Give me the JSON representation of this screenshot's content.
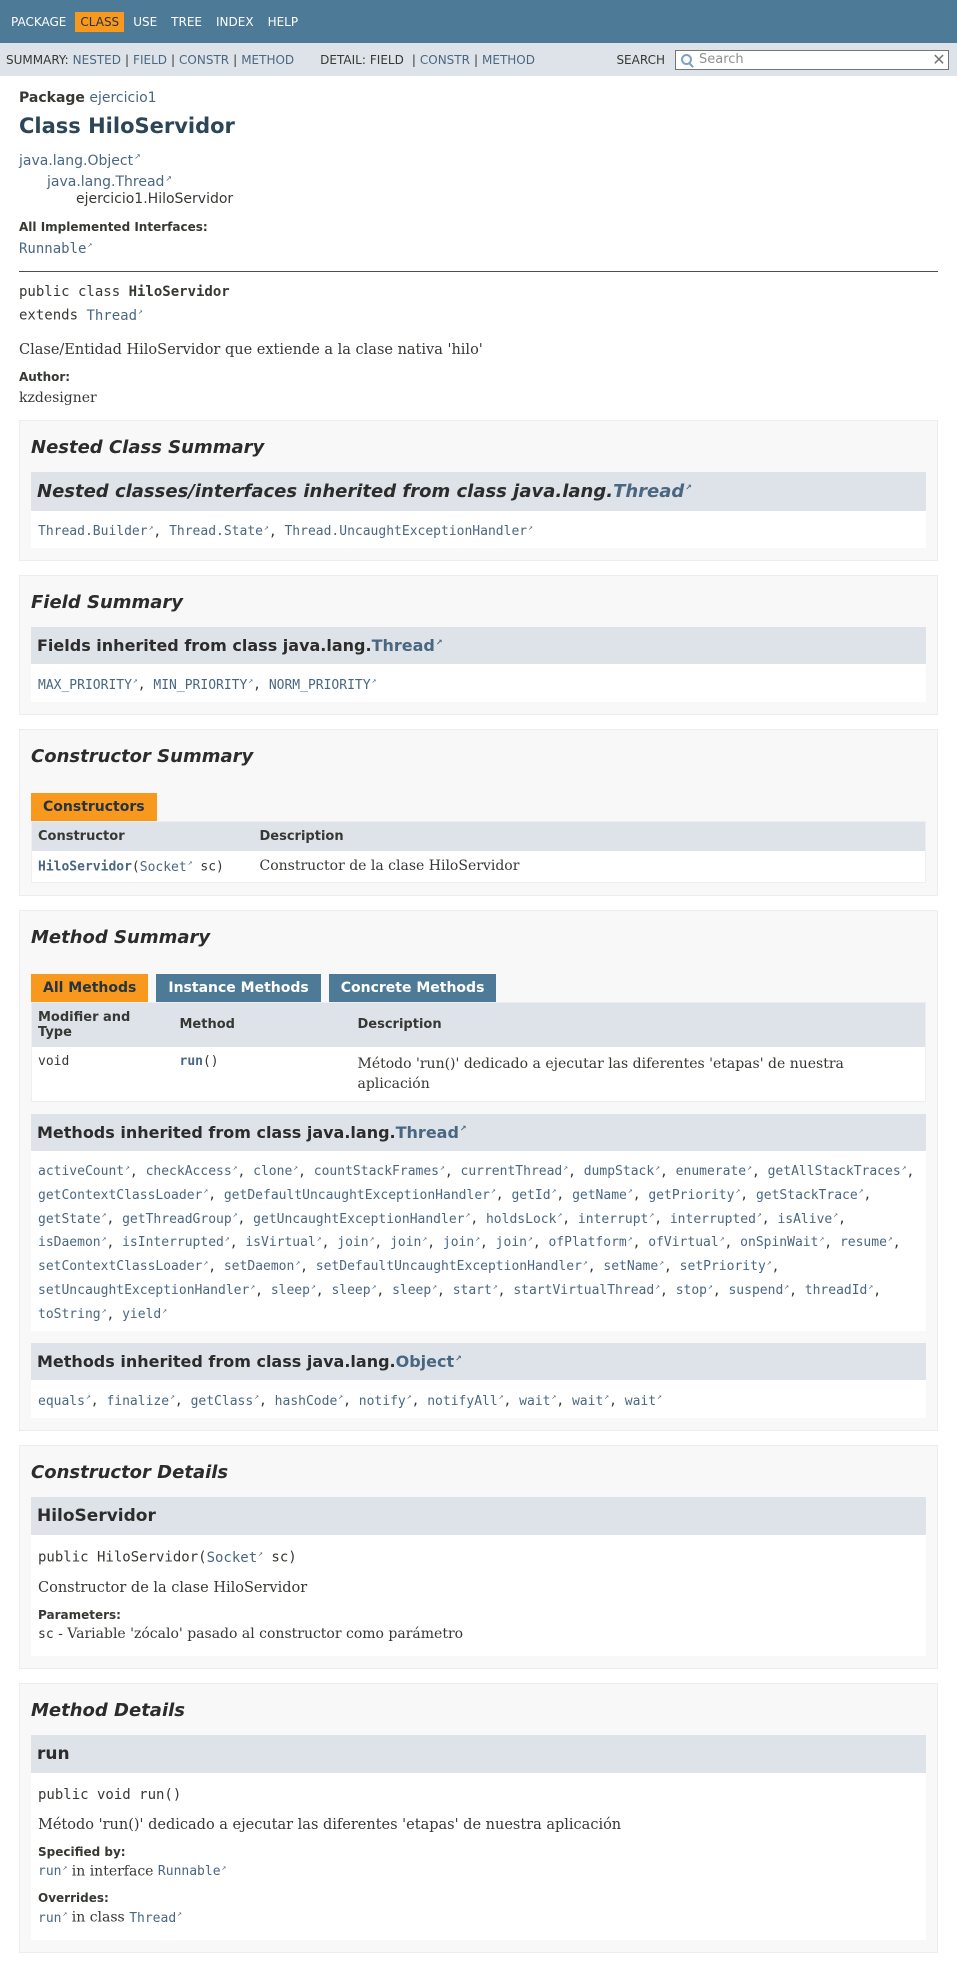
{
  "topnav": {
    "items": [
      {
        "label": "PACKAGE",
        "active": false
      },
      {
        "label": "CLASS",
        "active": true
      },
      {
        "label": "USE",
        "active": false
      },
      {
        "label": "TREE",
        "active": false
      },
      {
        "label": "INDEX",
        "active": false
      },
      {
        "label": "HELP",
        "active": false
      }
    ]
  },
  "subnav": {
    "summary_label": "SUMMARY:",
    "summary_links": [
      "NESTED",
      "FIELD",
      "CONSTR",
      "METHOD"
    ],
    "detail_label": "DETAIL:",
    "detail_plain": "FIELD",
    "detail_links": [
      "CONSTR",
      "METHOD"
    ],
    "search_label": "SEARCH",
    "search_placeholder": "Search",
    "search_value": "",
    "clear_glyph": "✕"
  },
  "header": {
    "package_label": "Package",
    "package_name": "ejercicio1",
    "title": "Class HiloServidor",
    "inheritance": [
      "java.lang.Object",
      "java.lang.Thread",
      "ejercicio1.HiloServidor"
    ],
    "impl_label": "All Implemented Interfaces:",
    "impl_value": "Runnable",
    "sig_line1_prefix": "public class ",
    "sig_line1_name": "HiloServidor",
    "sig_line2_prefix": "extends ",
    "sig_line2_link": "Thread",
    "description": "Clase/Entidad HiloServidor que extiende a la clase nativa 'hilo'",
    "author_label": "Author:",
    "author": "kzdesigner"
  },
  "nested": {
    "title": "Nested Class Summary",
    "inherited_prefix": "Nested classes/interfaces inherited from class java.lang.",
    "inherited_link": "Thread",
    "items": [
      "Thread.Builder",
      "Thread.State",
      "Thread.UncaughtExceptionHandler"
    ]
  },
  "fields": {
    "title": "Field Summary",
    "inherited_prefix": "Fields inherited from class java.lang.",
    "inherited_link": "Thread",
    "items": [
      "MAX_PRIORITY",
      "MIN_PRIORITY",
      "NORM_PRIORITY"
    ]
  },
  "constructors": {
    "title": "Constructor Summary",
    "tab": "Constructors",
    "col1": "Constructor",
    "col2": "Description",
    "row_name": "HiloServidor",
    "row_paren_open": "(",
    "row_param_type": "Socket",
    "row_param_rest": " sc)",
    "row_desc": "Constructor de la clase HiloServidor"
  },
  "methods": {
    "title": "Method Summary",
    "tabs": [
      {
        "label": "All Methods",
        "active": true
      },
      {
        "label": "Instance Methods",
        "active": false
      },
      {
        "label": "Concrete Methods",
        "active": false
      }
    ],
    "col1": "Modifier and Type",
    "col2": "Method",
    "col3": "Description",
    "row_type": "void",
    "row_name": "run",
    "row_parens": "()",
    "row_desc": "Método 'run()' dedicado a ejecutar las diferentes 'etapas' de nuestra aplicación",
    "thread_prefix": "Methods inherited from class java.lang.",
    "thread_link": "Thread",
    "thread_items": [
      "activeCount",
      "checkAccess",
      "clone",
      "countStackFrames",
      "currentThread",
      "dumpStack",
      "enumerate",
      "getAllStackTraces",
      "getContextClassLoader",
      "getDefaultUncaughtExceptionHandler",
      "getId",
      "getName",
      "getPriority",
      "getStackTrace",
      "getState",
      "getThreadGroup",
      "getUncaughtExceptionHandler",
      "holdsLock",
      "interrupt",
      "interrupted",
      "isAlive",
      "isDaemon",
      "isInterrupted",
      "isVirtual",
      "join",
      "join",
      "join",
      "join",
      "ofPlatform",
      "ofVirtual",
      "onSpinWait",
      "resume",
      "setContextClassLoader",
      "setDaemon",
      "setDefaultUncaughtExceptionHandler",
      "setName",
      "setPriority",
      "setUncaughtExceptionHandler",
      "sleep",
      "sleep",
      "sleep",
      "start",
      "startVirtualThread",
      "stop",
      "suspend",
      "threadId",
      "toString",
      "yield"
    ],
    "object_prefix": "Methods inherited from class java.lang.",
    "object_link": "Object",
    "object_items": [
      "equals",
      "finalize",
      "getClass",
      "hashCode",
      "notify",
      "notifyAll",
      "wait",
      "wait",
      "wait"
    ]
  },
  "constructor_details": {
    "title": "Constructor Details",
    "name": "HiloServidor",
    "sig_prefix": "public HiloServidor(",
    "sig_link": "Socket",
    "sig_suffix": " sc)",
    "description": "Constructor de la clase HiloServidor",
    "params_label": "Parameters:",
    "param_name": "sc",
    "param_desc": " - Variable 'zócalo' pasado al constructor como parámetro"
  },
  "method_details": {
    "title": "Method Details",
    "name": "run",
    "signature": "public void run()",
    "description": "Método 'run()' dedicado a ejecutar las diferentes 'etapas' de nuestra aplicación",
    "specified_label": "Specified by:",
    "specified_link": "run",
    "specified_mid": " in interface ",
    "specified_iface": "Runnable",
    "overrides_label": "Overrides:",
    "overrides_link": "run",
    "overrides_mid": " in class ",
    "overrides_class": "Thread"
  }
}
